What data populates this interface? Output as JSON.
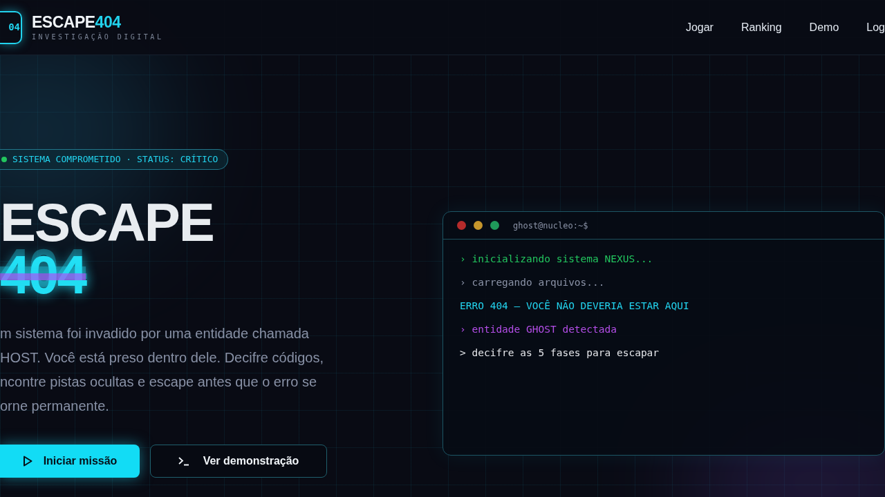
{
  "logo": {
    "badge": "04",
    "name": "ESCAPE",
    "name_accent": "404",
    "tagline": "INVESTIGAÇÃO DIGITAL"
  },
  "nav": [
    "Jogar",
    "Ranking",
    "Demo",
    "Log"
  ],
  "status_badge": {
    "text": "SISTEMA COMPROMETIDO · STATUS: CRÍTICO",
    "color": "#22c55e"
  },
  "headline": {
    "line_1": "ESCAPE",
    "line_2": "404"
  },
  "description": [
    "m sistema foi invadido por uma entidade chamada",
    "HOST. Você está preso dentro dele. Decifre códigos,",
    "ncontre pistas ocultas e escape antes que o erro se",
    "orne permanente."
  ],
  "buttons": [
    {
      "label": "Iniciar missão",
      "kind": "primary"
    },
    {
      "label": "Ver demonstração",
      "kind": "secondary"
    }
  ],
  "terminal": {
    "title": "ghost@nucleo:~$",
    "lines": [
      {
        "text": "› inicializando sistema NEXUS...",
        "kind": "success"
      },
      {
        "text": "› carregando arquivos...",
        "kind": "muted"
      },
      {
        "text": "ERRO 404 — VOCÊ NÃO DEVERIA ESTAR AQUI",
        "kind": "error"
      },
      {
        "text": "› entidade GHOST detectada",
        "kind": "ghost"
      },
      {
        "text": "> decifre as 5 fases para escapar",
        "kind": "prompt"
      }
    ]
  }
}
